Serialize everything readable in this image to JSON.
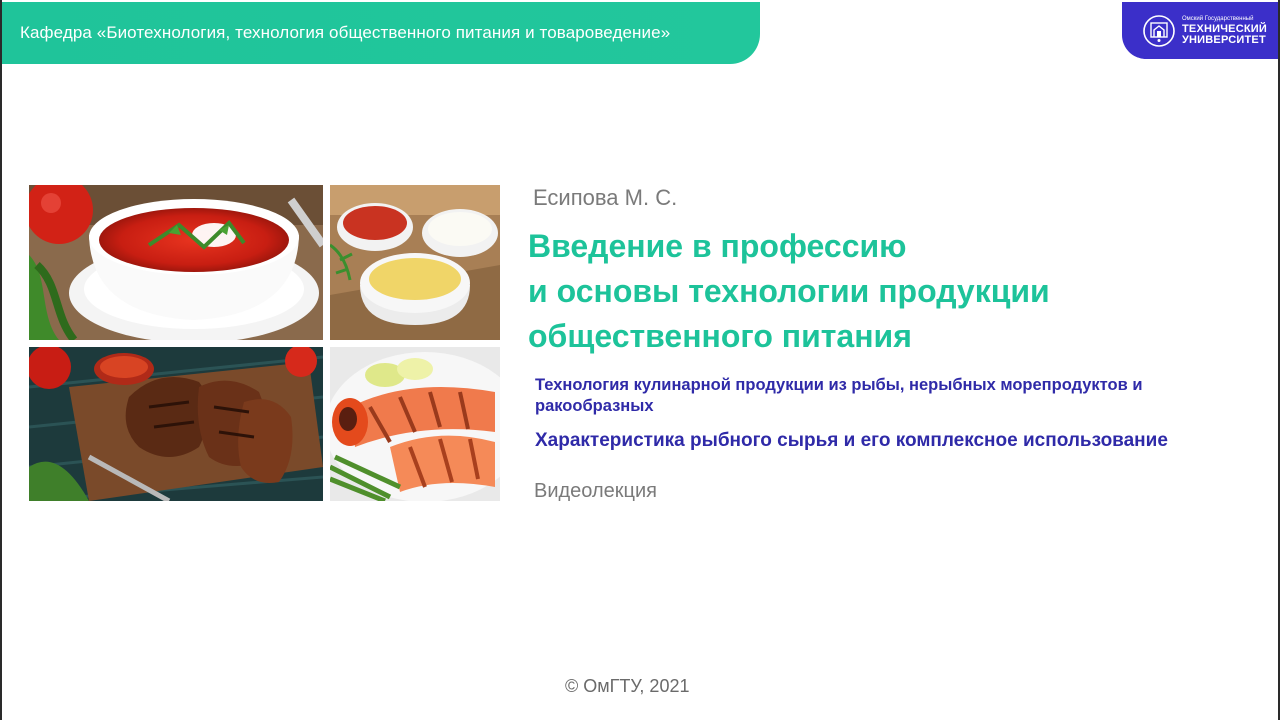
{
  "header": {
    "department": "Кафедра «Биотехнология, технология общественного питания и товароведение»"
  },
  "logo": {
    "line_small": "Омский Государственный",
    "line_1": "ТЕХНИЧЕСКИЙ",
    "line_2": "УНИВЕРСИТЕТ",
    "brand_color": "#3b2fc9"
  },
  "slide": {
    "author": "Есипова М. С.",
    "course_title_lines": [
      "Введение в профессию",
      "и основы технологии продукции",
      "общественного питания"
    ],
    "section": "Технология кулинарной продукции из рыбы, нерыбных морепродуктов и ракообразных",
    "lecture": "Характеристика рыбного сырья и его комплексное использование",
    "format": "Видеолекция"
  },
  "footer": {
    "copyright": "© ОмГТУ, 2021"
  },
  "colors": {
    "accent": "#1dc39a",
    "secondary": "#2f2aa8",
    "muted": "#7a7a7a"
  },
  "images": [
    {
      "name": "borscht-photo"
    },
    {
      "name": "sauces-photo"
    },
    {
      "name": "grilled-meat-photo"
    },
    {
      "name": "grilled-salmon-photo"
    }
  ]
}
